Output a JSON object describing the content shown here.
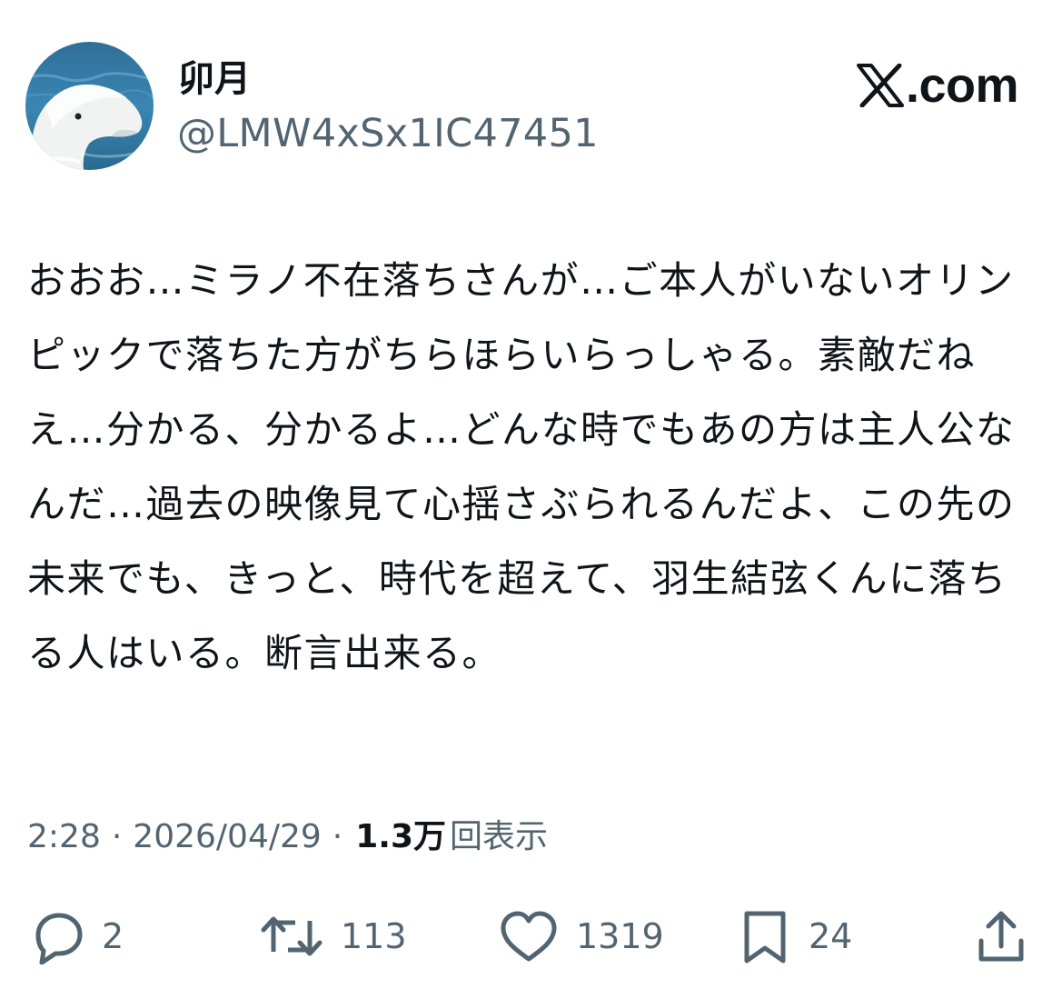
{
  "user": {
    "display_name": "卯月",
    "handle": "@LMW4xSx1IC47451",
    "avatar_icon": "beluga-avatar"
  },
  "brand": {
    "logo_icon": "x-logo-icon",
    "text": ".com"
  },
  "tweet": {
    "text": "おおお…ミラノ不在落ちさんが…ご本人がいないオリンピックで落ちた方がちらほらいらっしゃる。素敵だねえ…分かる、分かるよ…どんな時でもあの方は主人公なんだ…過去の映像見て心揺さぶられるんだよ、この先の未来でも、きっと、時代を超えて、羽生結弦くんに落ちる人はいる。断言出来る。"
  },
  "meta": {
    "time": "2:28",
    "separator": "·",
    "date": "2026/04/29",
    "views_count": "1.3万",
    "views_label": "回表示"
  },
  "actions": {
    "reply": {
      "icon": "reply-icon",
      "count": "2"
    },
    "retweet": {
      "icon": "retweet-icon",
      "count": "113"
    },
    "like": {
      "icon": "heart-icon",
      "count": "1319"
    },
    "bookmark": {
      "icon": "bookmark-icon",
      "count": "24"
    },
    "share": {
      "icon": "share-icon"
    }
  },
  "colors": {
    "text_primary": "#0f1419",
    "text_secondary": "#536471",
    "background": "#ffffff"
  }
}
